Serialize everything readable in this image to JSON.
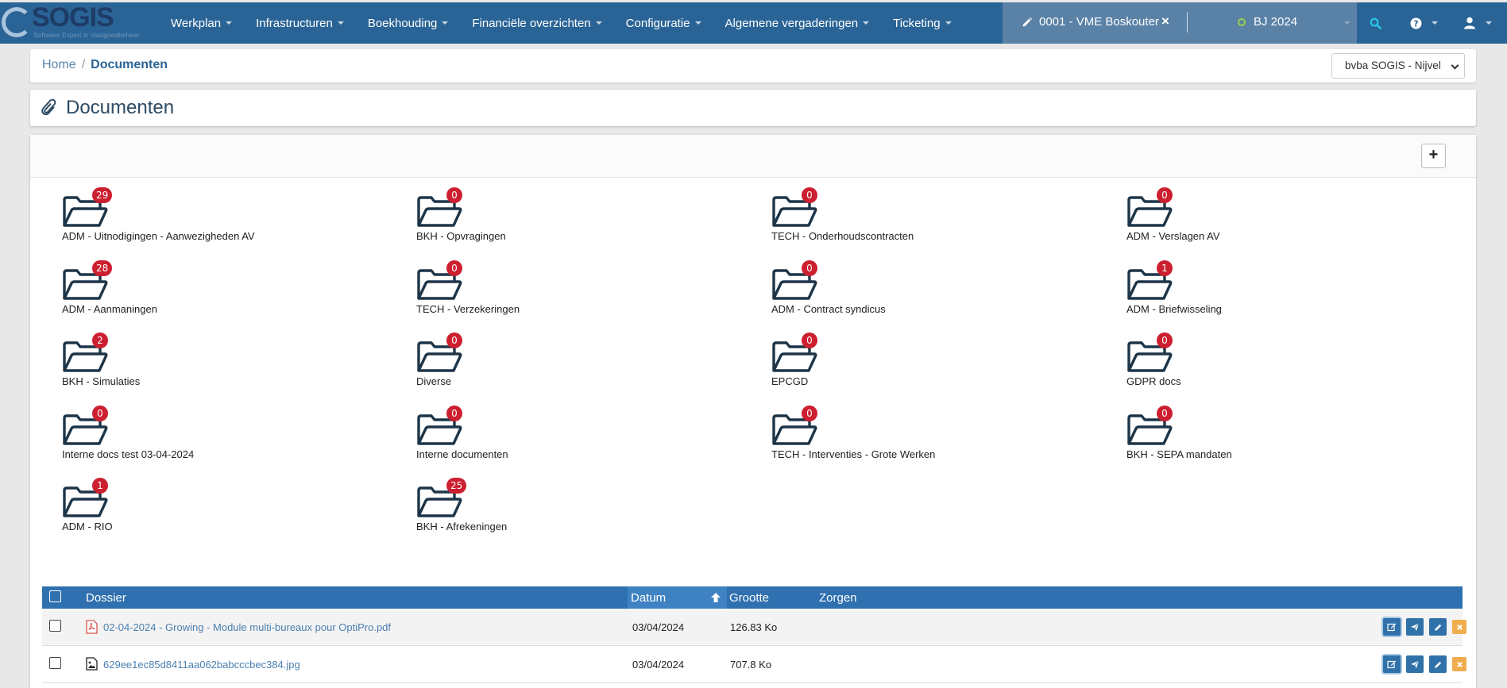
{
  "app": {
    "logo_text": "SOGIS",
    "logo_subtitle": "Software Expert in Vastgoedbeheer"
  },
  "nav": {
    "items": [
      "Werkplan",
      "Infrastructuren",
      "Boekhouding",
      "Financiële overzichten",
      "Configuratie",
      "Algemene vergaderingen",
      "Ticketing"
    ],
    "vme": "0001 - VME Boskouter",
    "close_label": "×",
    "fiscal_year": "BJ 2024"
  },
  "breadcrumb": {
    "home": "Home",
    "separator": "/",
    "current": "Documenten"
  },
  "company_select": {
    "value": "bvba SOGIS - Nijvel"
  },
  "page": {
    "title": "Documenten",
    "add_label": "+"
  },
  "folders": [
    {
      "name": "ADM - Uitnodigingen - Aanwezigheden AV",
      "count": "29"
    },
    {
      "name": "BKH - Opvragingen",
      "count": "0"
    },
    {
      "name": "TECH - Onderhoudscontracten",
      "count": "0"
    },
    {
      "name": "ADM - Verslagen AV",
      "count": "0"
    },
    {
      "name": "ADM - Aanmaningen",
      "count": "28"
    },
    {
      "name": "TECH - Verzekeringen",
      "count": "0"
    },
    {
      "name": "ADM - Contract syndicus",
      "count": "0"
    },
    {
      "name": "ADM - Briefwisseling",
      "count": "1"
    },
    {
      "name": "BKH - Simulaties",
      "count": "2"
    },
    {
      "name": "Diverse",
      "count": "0"
    },
    {
      "name": "EPCGD",
      "count": "0"
    },
    {
      "name": "GDPR docs",
      "count": "0"
    },
    {
      "name": "Interne docs test 03-04-2024",
      "count": "0"
    },
    {
      "name": "Interne documenten",
      "count": "0"
    },
    {
      "name": "TECH - Interventies - Grote Werken",
      "count": "0"
    },
    {
      "name": "BKH - SEPA mandaten",
      "count": "0"
    },
    {
      "name": "ADM - RIO",
      "count": "1"
    },
    {
      "name": "BKH - Afrekeningen",
      "count": "25"
    }
  ],
  "table": {
    "headers": {
      "dossier": "Dossier",
      "datum": "Datum",
      "grootte": "Grootte",
      "zorgen": "Zorgen"
    },
    "rows": [
      {
        "name": "02-04-2024 - Growing - Module multi-bureaux pour OptiPro.pdf",
        "date": "03/04/2024",
        "size": "126.83 Ko",
        "type_icon": "pdf-icon"
      },
      {
        "name": "629ee1ec85d8411aa062babcccbec384.jpg",
        "date": "03/04/2024",
        "size": "707.8 Ko",
        "type_icon": "image-icon"
      }
    ]
  },
  "colors": {
    "navbar": "#2a6496",
    "vme_box": "#5a81a6",
    "badge": "#cc1f2f",
    "table_header": "#2f70b0",
    "action_blue": "#3071a9",
    "action_orange": "#f0ad4e"
  }
}
